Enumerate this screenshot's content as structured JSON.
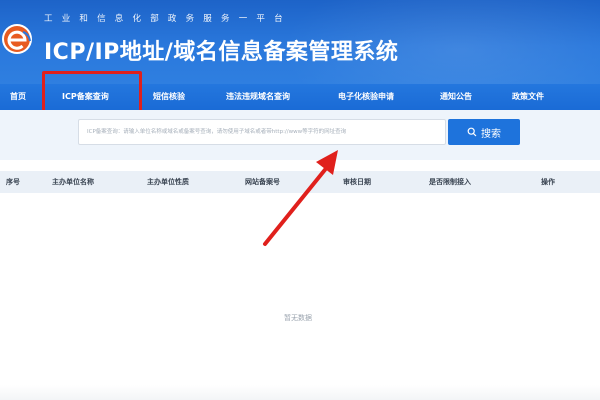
{
  "header": {
    "subtitle": "工业和信息化部政务服务一平台",
    "title": "ICP/IP地址/域名信息备案管理系统",
    "logo_icon": "e-logo-icon",
    "bg_color": "#1d63c8"
  },
  "nav": {
    "items": [
      {
        "label": "首页"
      },
      {
        "label": "ICP备案查询"
      },
      {
        "label": "短信核验"
      },
      {
        "label": "违法违规域名查询"
      },
      {
        "label": "电子化核验申请"
      },
      {
        "label": "通知公告"
      },
      {
        "label": "政策文件"
      }
    ],
    "highlighted": "ICP备案查询",
    "highlight_color": "#e0201c"
  },
  "search": {
    "placeholder": "ICP备案查询：请输入单位名称或域名或备案号查询，请勿使用子域名或者带http://www等字符的网址查询",
    "button_label": "搜索",
    "button_icon": "search-icon"
  },
  "table": {
    "columns": [
      "序号",
      "主办单位名称",
      "主办单位性质",
      "网站备案号",
      "审核日期",
      "是否限制接入",
      "操作"
    ],
    "rows": [],
    "empty_text": "暂无数据"
  },
  "annotation": {
    "arrow_color": "#e0201c",
    "arrow_icon": "red-arrow-icon"
  }
}
